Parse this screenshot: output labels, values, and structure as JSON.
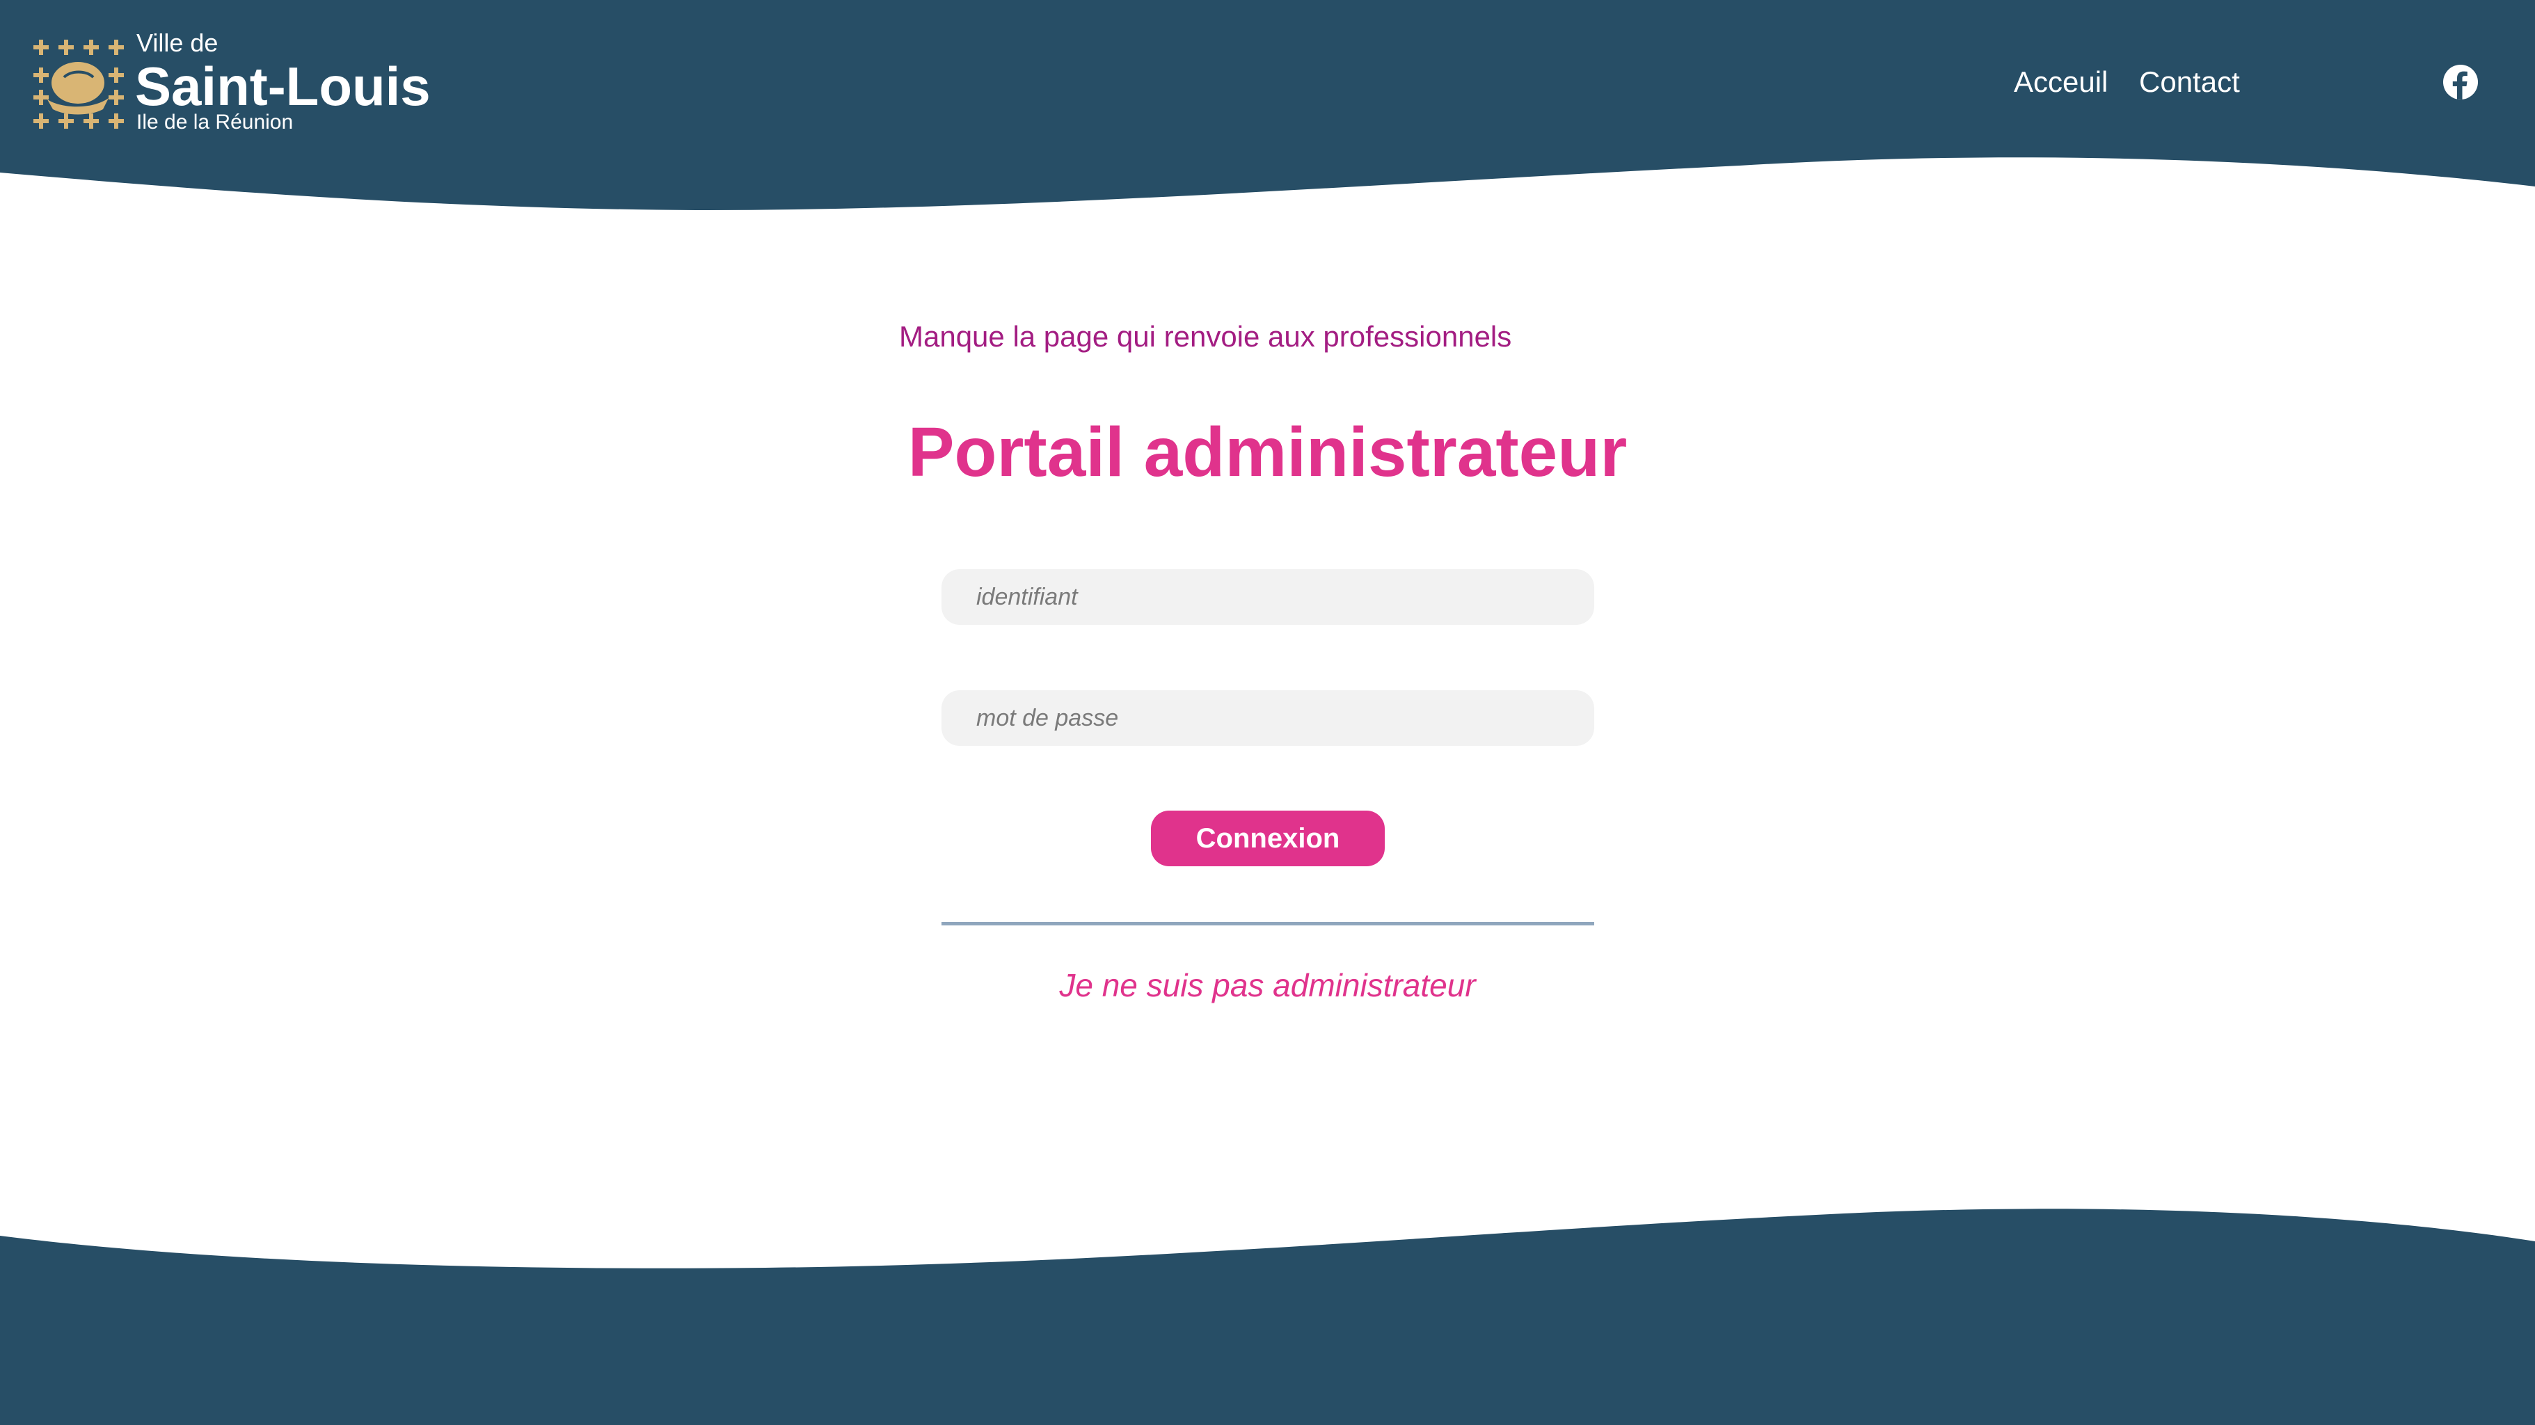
{
  "colors": {
    "header_bg": "#274e66",
    "accent_pink": "#e0338c",
    "note_magenta": "#a31d82",
    "logo_gold": "#d9b574",
    "field_bg": "#f2f2f2",
    "divider": "#8fa6bd"
  },
  "header": {
    "logo": {
      "pre_title": "Ville de",
      "title": "Saint-Louis",
      "subtitle": "Ile de la Réunion",
      "emblem_icon": "city-coat-of-arms-icon"
    },
    "nav": {
      "items": [
        {
          "label": "Acceuil"
        },
        {
          "label": "Contact"
        }
      ]
    },
    "social": {
      "icon": "facebook-icon"
    }
  },
  "main": {
    "note": "Manque la page qui renvoie aux professionnels",
    "title": "Portail administrateur",
    "form": {
      "username_placeholder": "identifiant",
      "username_value": "",
      "password_placeholder": "mot de passe",
      "password_value": "",
      "submit_label": "Connexion"
    },
    "alt_link": "Je ne suis pas administrateur"
  }
}
